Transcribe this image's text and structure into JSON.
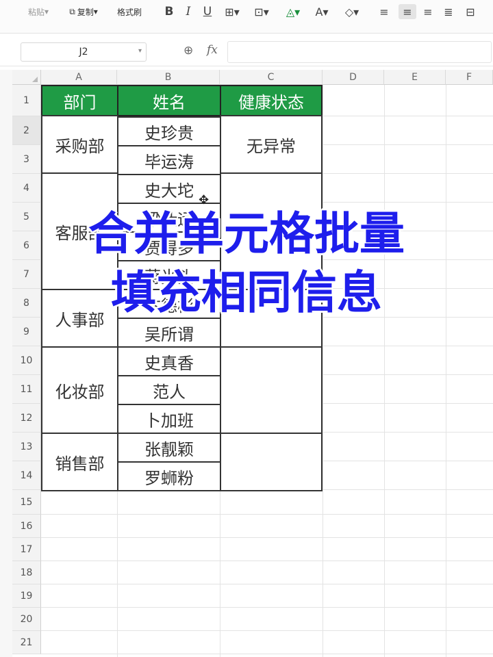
{
  "toolbar": {
    "paste_label": "粘贴",
    "copy_label": "复制",
    "format_painter_label": "格式刷",
    "bold": "B",
    "italic": "I",
    "underline": "U"
  },
  "formula_bar": {
    "name_box": "J2",
    "fx": "fx"
  },
  "columns": [
    "A",
    "B",
    "C",
    "D",
    "E",
    "F"
  ],
  "rows": [
    "1",
    "2",
    "3",
    "4",
    "5",
    "6",
    "7",
    "8",
    "9",
    "10",
    "11",
    "12",
    "13",
    "14",
    "15",
    "16",
    "17",
    "18",
    "19",
    "20",
    "21"
  ],
  "table": {
    "headers": [
      "部门",
      "姓名",
      "健康状态"
    ],
    "departments": [
      "采购部",
      "客服部",
      "人事部",
      "化妆部",
      "销售部"
    ],
    "names": [
      "史珍贵",
      "毕运涛",
      "史大坨",
      "梁仕远",
      "贾得多",
      "蒋光头",
      "卞德彬",
      "吴所谓",
      "史真香",
      "范人",
      "卜加班",
      "张靓颖",
      "罗蛳粉"
    ],
    "status": [
      "无异常"
    ]
  },
  "overlay": {
    "line1": "合并单元格批量",
    "line2": "填充相同信息"
  },
  "colors": {
    "header_green": "#1f9b45",
    "overlay_blue": "#1e1eec"
  }
}
